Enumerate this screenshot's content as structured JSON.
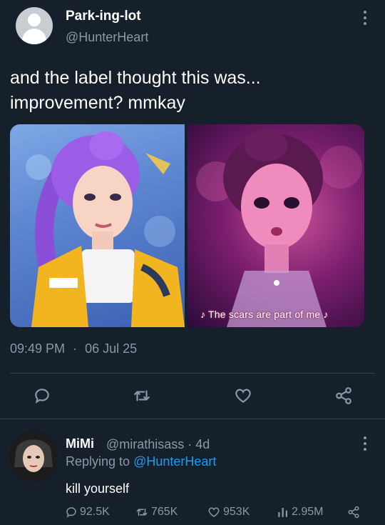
{
  "tweet": {
    "author_name": "Park-ing-lot",
    "author_handle": "@HunterHeart",
    "text_line1": "and the label thought this was...",
    "text_line2": "improvement? mmkay",
    "image_caption": "♪ The scars are part of me ♪",
    "time": "09:49 PM",
    "separator": "·",
    "date": "06 Jul 25"
  },
  "actions": [
    "reply-icon",
    "retweet-icon",
    "like-icon",
    "share-icon"
  ],
  "reply": {
    "name": "MiMi",
    "handle_time": "@mirathisass · 4d",
    "replying_prefix": "Replying to ",
    "replying_to": "@HunterHeart",
    "text": "kill yourself",
    "stats": {
      "replies": "92.5K",
      "retweets": "765K",
      "likes": "953K",
      "views": "2.95M"
    }
  },
  "colors": {
    "background": "#15202b",
    "secondary_text": "#8b98a5",
    "link": "#1d9bf0",
    "divider": "#38444d"
  }
}
